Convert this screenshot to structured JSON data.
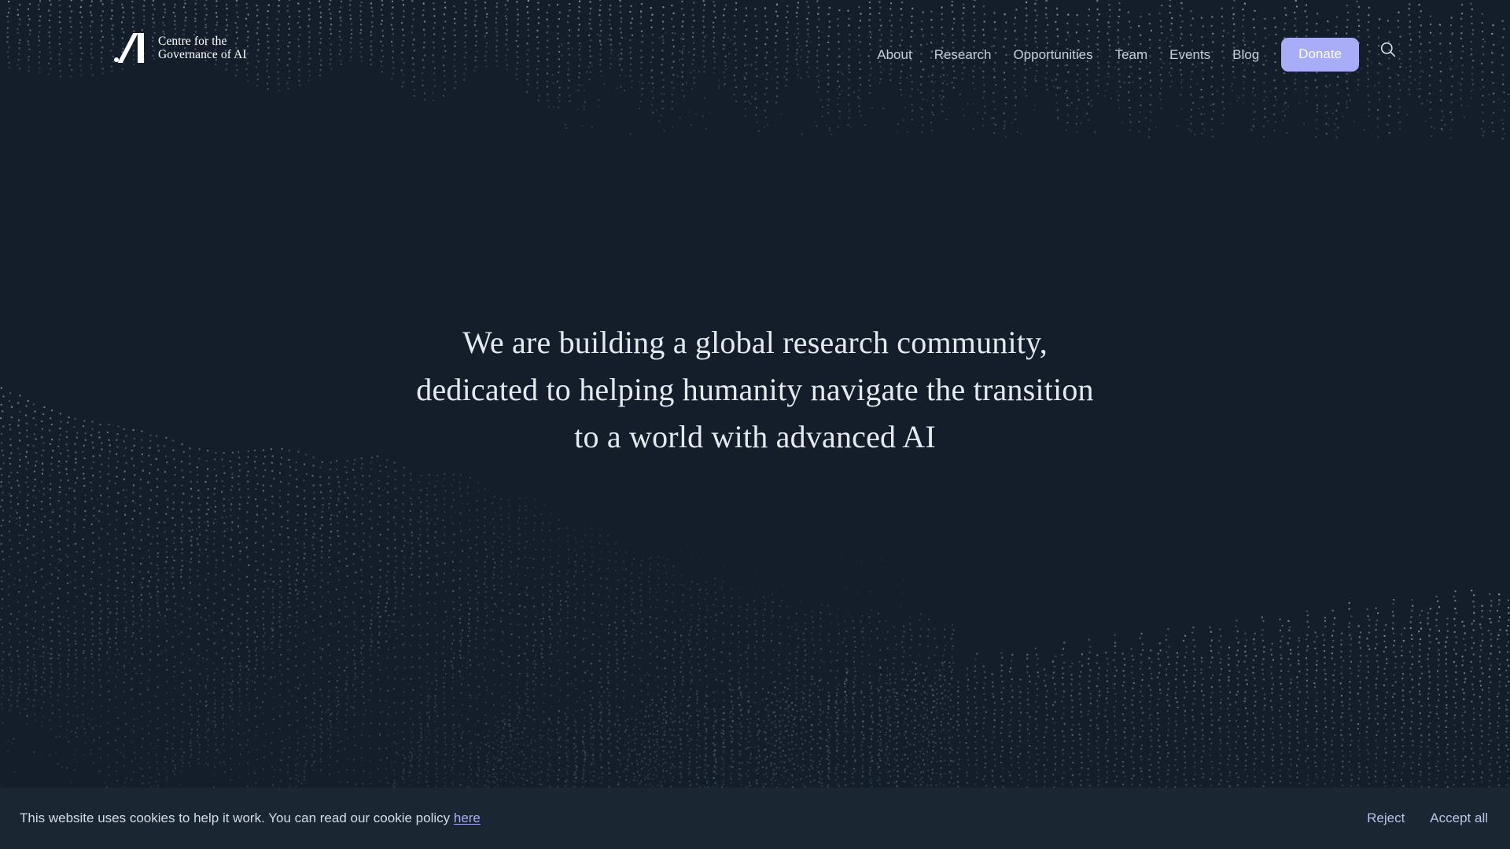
{
  "brand": {
    "logo_icon": "govai-logo-icon",
    "name_line1": "Centre for the",
    "name_line2": "Governance of AI"
  },
  "header": {
    "nav": [
      {
        "label": "About"
      },
      {
        "label": "Research"
      },
      {
        "label": "Opportunities"
      },
      {
        "label": "Team"
      },
      {
        "label": "Events"
      },
      {
        "label": "Blog"
      }
    ],
    "donate_label": "Donate",
    "donate_color": "#a9acf7",
    "search_icon": "search-icon"
  },
  "hero": {
    "headline_line1": "We are building a global research community,",
    "headline_line2": "dedicated to helping humanity navigate the transition",
    "headline_line3": "to a world with advanced AI",
    "background_color": "#141e2a",
    "particle_color": "#b8cbe6"
  },
  "cookie_banner": {
    "message_before_link": "This website uses cookies to help it work. You can read our cookie policy ",
    "link_label": "here",
    "reject_label": "Reject",
    "accept_label": "Accept all",
    "background_color": "#1b2633",
    "link_color": "#a9acf7"
  }
}
